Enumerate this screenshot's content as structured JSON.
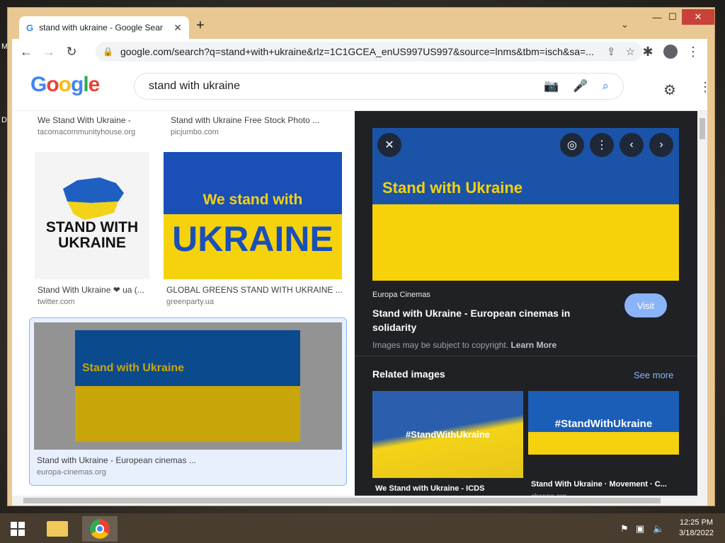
{
  "window": {
    "minimize": "—",
    "maximize": "☐",
    "close": "✕"
  },
  "tab": {
    "favicon": "G",
    "title": "stand with ukraine - Google Sear",
    "close": "✕",
    "new_tab": "+",
    "dropdown": "⌄"
  },
  "toolbar": {
    "back": "←",
    "forward": "→",
    "reload": "↻",
    "url": "google.com/search?q=stand+with+ukraine&rlz=1C1GCEA_enUS997US997&source=lnms&tbm=isch&sa=..."
  },
  "search": {
    "query": "stand with ukraine"
  },
  "results": [
    {
      "title": "We Stand With Ukraine -",
      "source": "tacomacommunityhouse.org"
    },
    {
      "title": "Stand with Ukraine Free Stock Photo ...",
      "source": "picjumbo.com"
    },
    {
      "title": "Stand With Ukraine ❤ ua (...",
      "source": "twitter.com",
      "image_text": "STAND WITH UKRAINE"
    },
    {
      "title": "GLOBAL GREENS STAND WITH UKRAINE ...",
      "source": "greenparty.ua",
      "image_line1": "We stand with",
      "image_line2": "UKRAINE"
    },
    {
      "title": "Stand with Ukraine - European cinemas ...",
      "source": "europa-cinemas.org",
      "image_text": "Stand with Ukraine"
    }
  ],
  "preview": {
    "image_text": "Stand with Ukraine",
    "site": "Europa Cinemas",
    "title": "Stand with Ukraine - European cinemas in solidarity",
    "visit": "Visit",
    "copyright": "Images may be subject to copyright.",
    "learn_more": "Learn More",
    "related_heading": "Related images",
    "see_more": "See more",
    "related": [
      {
        "image_text": "#StandWithUkraine",
        "caption": "We Stand with Ukraine - ICDS"
      },
      {
        "image_text": "#StandWithUkraine",
        "caption": "Stand With Ukraine · Movement · C...",
        "source": "change.org"
      }
    ]
  },
  "taskbar": {
    "time": "12:25 PM",
    "date": "3/18/2022"
  },
  "colors": {
    "ukraine_blue": "#0a57b7",
    "ukraine_yellow": "#f7d10a",
    "google_blue": "#4285f4"
  }
}
